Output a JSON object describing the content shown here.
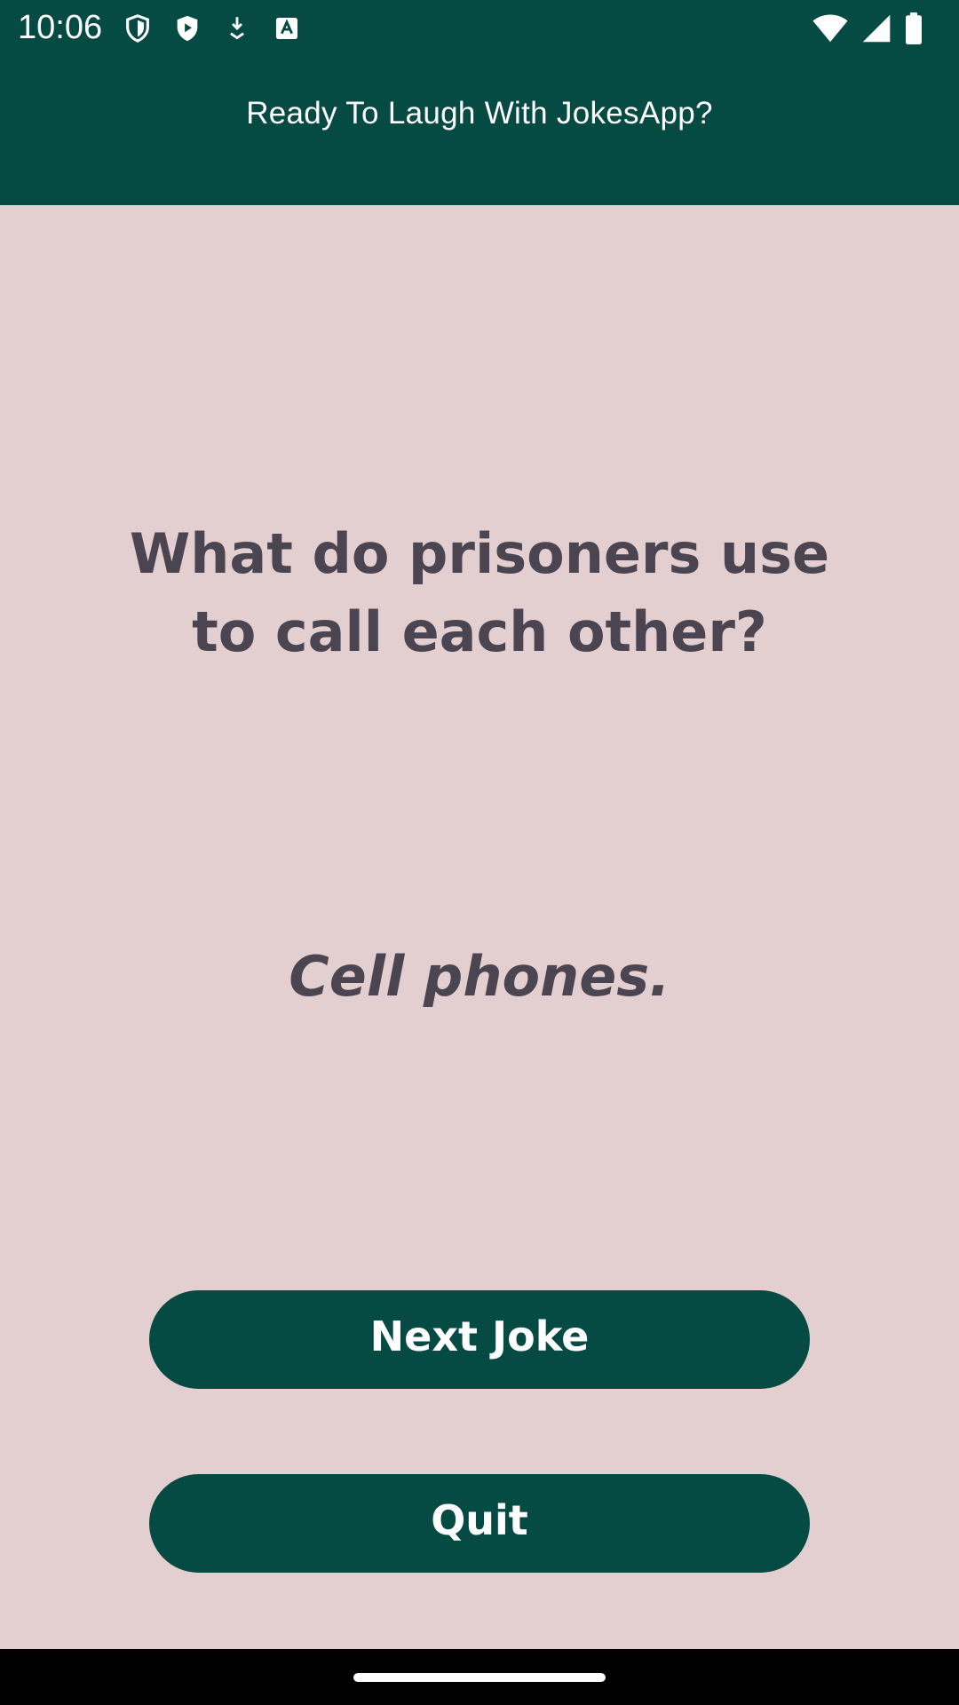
{
  "status_bar": {
    "time": "10:06",
    "left_icons": [
      "shield-icon",
      "play-protect-icon",
      "download-icon",
      "font-a-icon"
    ],
    "right_icons": [
      "wifi-icon",
      "cell-signal-icon",
      "battery-icon"
    ]
  },
  "app_bar": {
    "title": "Ready To Laugh With JokesApp?"
  },
  "joke": {
    "question": "What do prisoners use to call each other?",
    "answer": "Cell phones."
  },
  "buttons": {
    "next_label": "Next Joke",
    "quit_label": "Quit"
  },
  "colors": {
    "primary": "#054A43",
    "background": "#E4CFD0",
    "text": "#4A4550",
    "on_primary": "#FFFFFF"
  }
}
